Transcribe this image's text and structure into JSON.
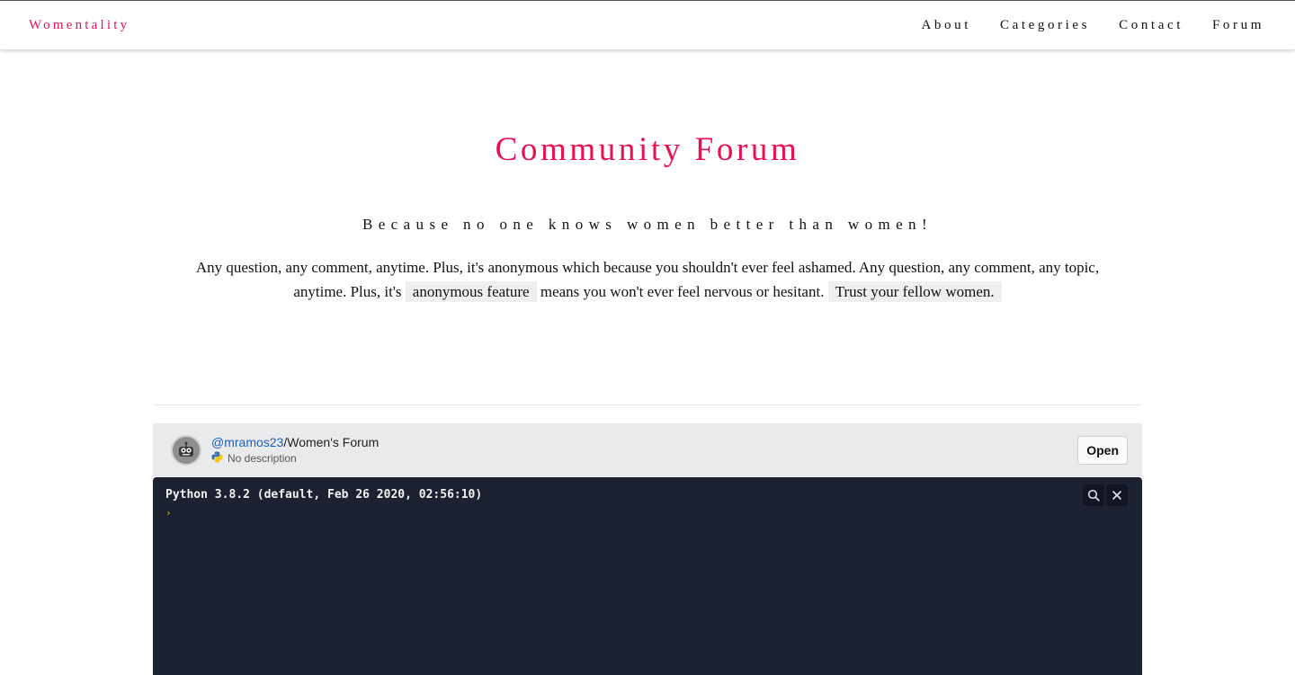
{
  "nav": {
    "brand": "Womentality",
    "links": [
      "About",
      "Categories",
      "Contact",
      "Forum"
    ]
  },
  "hero": {
    "title": "Community Forum",
    "tagline": "Because no one knows women better than women!",
    "intro_part1": "Any question, any comment, anytime. Plus, it's anonymous which because you shouldn't ever feel ashamed. Any question, any comment, any topic, anytime. Plus, it's",
    "highlight1": "anonymous feature",
    "intro_part2": "means you won't ever feel nervous or hesitant.",
    "highlight2": "Trust your fellow women."
  },
  "repl": {
    "user": "@mramos23",
    "separator": "/",
    "name": "Women's Forum",
    "description": "No description",
    "open_label": "Open",
    "console_line": "Python 3.8.2 (default, Feb 26 2020, 02:56:10)",
    "prompt_symbol": "›"
  },
  "colors": {
    "accent": "#e8104f",
    "console_bg": "#1d2233",
    "header_bg": "#e9eaec",
    "link_blue": "#1a5fbf"
  },
  "icons": {
    "avatar": "robot-avatar-icon",
    "language": "python-icon",
    "search": "search-icon",
    "close": "close-icon"
  }
}
